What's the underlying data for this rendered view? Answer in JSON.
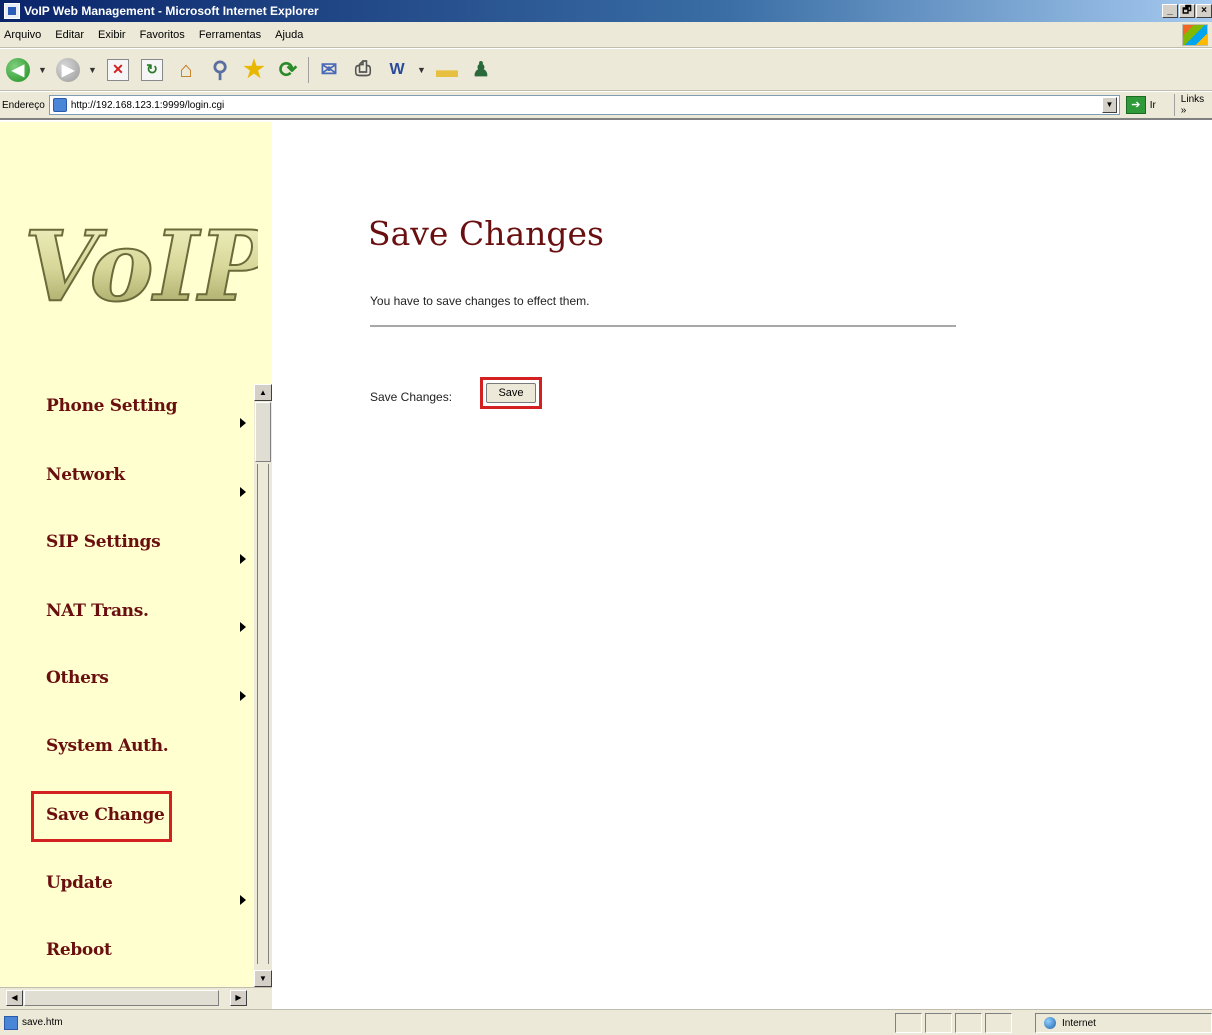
{
  "window": {
    "title": "VoIP Web Management - Microsoft Internet Explorer",
    "buttons": [
      "_",
      "🗗",
      "×"
    ]
  },
  "menu": {
    "items": [
      "Arquivo",
      "Editar",
      "Exibir",
      "Favoritos",
      "Ferramentas",
      "Ajuda"
    ]
  },
  "toolbar": {
    "icons": [
      "back-icon",
      "forward-icon",
      "stop-icon",
      "refresh-icon",
      "home-icon",
      "search-icon",
      "favorites-icon",
      "media-icon",
      "mail-icon",
      "print-icon",
      "edit-icon",
      "folder-icon",
      "messenger-icon"
    ]
  },
  "address": {
    "label": "Endereço",
    "url": "http://192.168.123.1:9999/login.cgi",
    "go_label": "Ir",
    "links_label": "Links »"
  },
  "sidebar": {
    "logo_text": "VoIP",
    "items": [
      {
        "label": "Phone Setting",
        "submenu": true
      },
      {
        "label": "Network",
        "submenu": true
      },
      {
        "label": "SIP Settings",
        "submenu": true
      },
      {
        "label": "NAT Trans.",
        "submenu": true
      },
      {
        "label": "Others",
        "submenu": true
      },
      {
        "label": "System Auth.",
        "submenu": false
      },
      {
        "label": "Save Change",
        "submenu": false,
        "highlighted": true
      },
      {
        "label": "Update",
        "submenu": true
      },
      {
        "label": "Reboot",
        "submenu": false
      }
    ]
  },
  "main": {
    "title": "Save Changes",
    "description": "You have to save changes to effect them.",
    "save_label": "Save Changes:",
    "save_button": "Save"
  },
  "status": {
    "text": "save.htm",
    "zone": "Internet"
  },
  "colors": {
    "nav_text": "#6a0f0f",
    "sidebar_bg": "#ffffd0",
    "highlight": "#d32020"
  }
}
